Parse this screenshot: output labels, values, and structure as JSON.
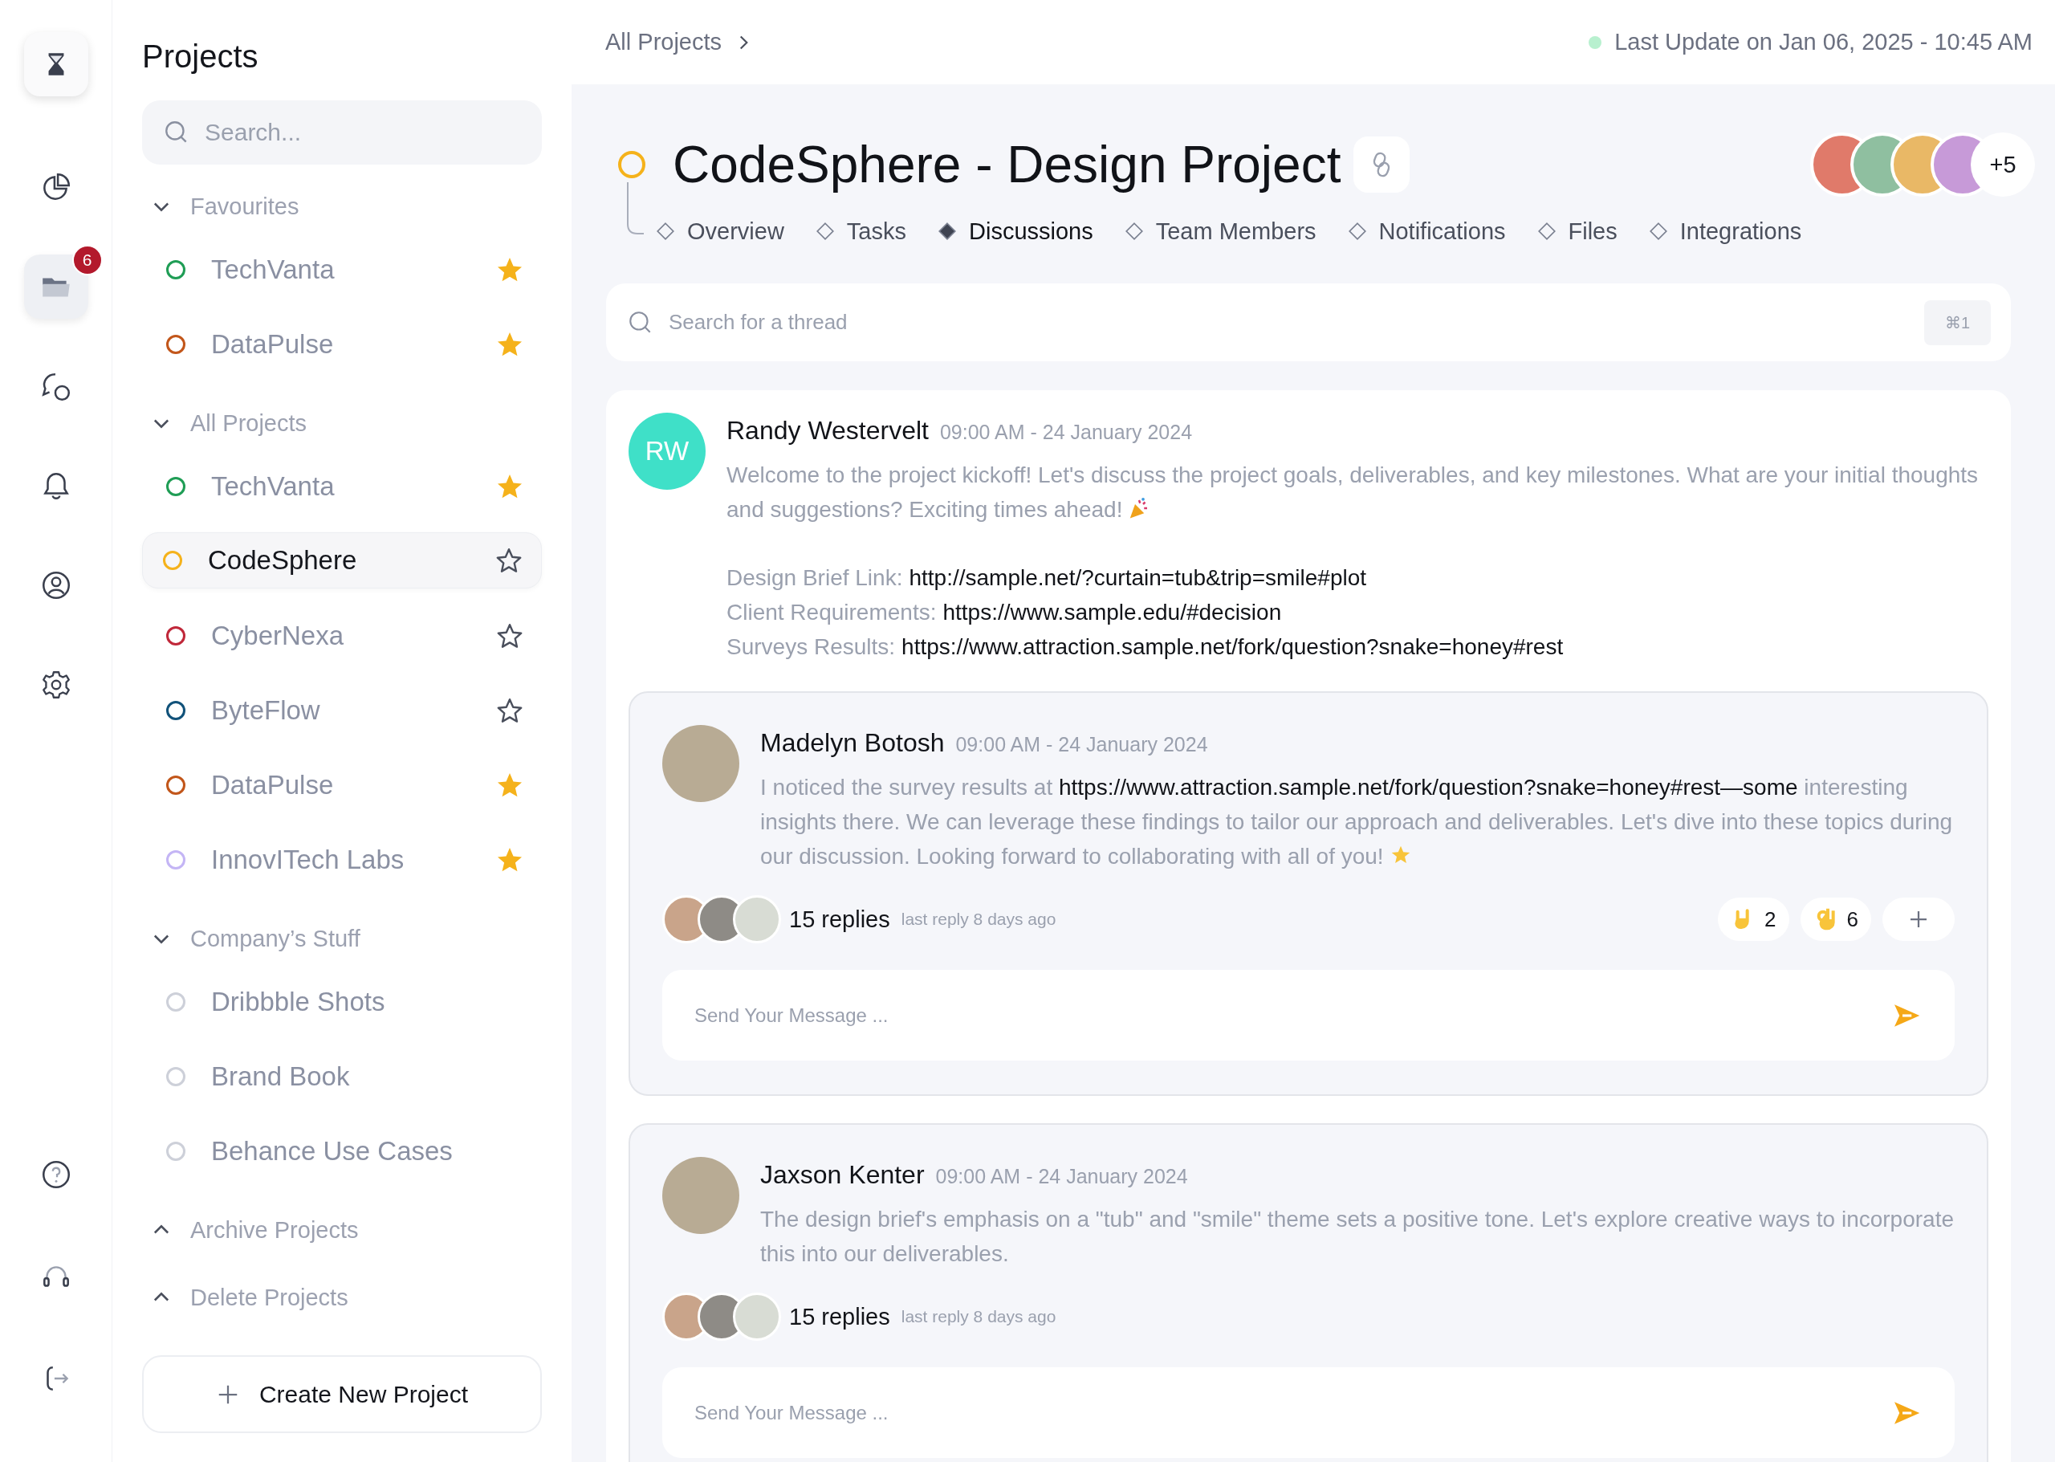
{
  "rail": {
    "top": [
      {
        "kind": "chart",
        "selected": false
      },
      {
        "kind": "folder",
        "selected": true,
        "badge": "6"
      },
      {
        "kind": "chat",
        "selected": false
      },
      {
        "kind": "bell",
        "selected": false
      },
      {
        "kind": "user",
        "selected": false
      },
      {
        "kind": "gear",
        "selected": false
      }
    ],
    "bottom": [
      {
        "kind": "help",
        "selected": false
      },
      {
        "kind": "headset",
        "selected": false
      },
      {
        "kind": "logout",
        "selected": false
      }
    ]
  },
  "sidebar": {
    "title": "Projects",
    "search": {
      "placeholder": "Search..."
    },
    "sections": [
      {
        "label": "Favourites",
        "expanded": true,
        "items": [
          {
            "name": "TechVanta",
            "color": "#1f9d55",
            "starred": true,
            "selected": false
          },
          {
            "name": "DataPulse",
            "color": "#c2561a",
            "starred": true,
            "selected": false
          }
        ]
      },
      {
        "label": "All Projects",
        "expanded": true,
        "items": [
          {
            "name": "TechVanta",
            "color": "#1f9d55",
            "starred": true,
            "selected": false
          },
          {
            "name": "CodeSphere",
            "color": "#f5b21b",
            "starred": false,
            "selected": true
          },
          {
            "name": "CyberNexa",
            "color": "#c0283a",
            "starred": false,
            "selected": false
          },
          {
            "name": "ByteFlow",
            "color": "#11527a",
            "starred": false,
            "selected": false
          },
          {
            "name": "DataPulse",
            "color": "#c2561a",
            "starred": true,
            "selected": false
          },
          {
            "name": "InnovITech Labs",
            "color": "#c4b5f5",
            "starred": true,
            "selected": false
          }
        ]
      },
      {
        "label": "Company’s Stuff",
        "expanded": true,
        "items": [
          {
            "name": "Dribbble Shots",
            "color": "#cdd0d9",
            "selected": false
          },
          {
            "name": "Brand Book",
            "color": "#cdd0d9",
            "selected": false
          },
          {
            "name": "Behance Use Cases",
            "color": "#cdd0d9",
            "selected": false
          }
        ]
      },
      {
        "label": "Archive Projects",
        "expanded": false
      },
      {
        "label": "Delete Projects",
        "expanded": false
      }
    ],
    "create_button": "Create New Project"
  },
  "header": {
    "breadcrumb": "All Projects",
    "last_update": "Last Update on Jan 06, 2025 - 10:45 AM"
  },
  "project": {
    "title": "CodeSphere - Design Project",
    "more_members": "+5",
    "tabs": [
      {
        "label": "Overview",
        "selected": false
      },
      {
        "label": "Tasks",
        "selected": false
      },
      {
        "label": "Discussions",
        "selected": true
      },
      {
        "label": "Team Members",
        "selected": false
      },
      {
        "label": "Notifications",
        "selected": false
      },
      {
        "label": "Files",
        "selected": false
      },
      {
        "label": "Integrations",
        "selected": false
      }
    ]
  },
  "thread_search": {
    "placeholder": "Search for a thread",
    "shortcut": "⌘1"
  },
  "post": {
    "initials": "RW",
    "author": "Randy Westervelt",
    "time": "09:00 AM - 24 January 2024",
    "body": "Welcome to the project kickoff! Let's discuss the project goals, deliverables, and key milestones. What are your initial thoughts and suggestions? Exciting times ahead!",
    "links": [
      {
        "label": "Design Brief Link:",
        "url": "http://sample.net/?curtain=tub&trip=smile#plot"
      },
      {
        "label": "Client Requirements:",
        "url": "https://www.sample.edu/#decision"
      },
      {
        "label": "Surveys Results:",
        "url": "https://www.attraction.sample.net/fork/question?snake=honey#rest"
      }
    ],
    "threads": [
      {
        "author": "Madelyn Botosh",
        "time": "09:00 AM - 24 January 2024",
        "body": [
          {
            "kind": "text",
            "text": "I noticed the survey results at "
          },
          {
            "kind": "link",
            "text": "https://www.attraction.sample.net/fork/question?snake=honey#rest—some"
          },
          {
            "kind": "text",
            "text": " interesting insights there. We can leverage these findings to tailor our approach and deliverables. Let's dive into these topics during our discussion. Looking forward to collaborating with all of you!"
          }
        ],
        "replies": "15 replies",
        "last_reply": "last reply 8 days ago",
        "reactions": [
          {
            "kind": "rock",
            "count": "2"
          },
          {
            "kind": "ok",
            "count": "6"
          }
        ],
        "composer": {
          "placeholder": "Send Your Message ..."
        }
      },
      {
        "author": "Jaxson Kenter",
        "time": "09:00 AM - 24 January 2024",
        "body": [
          {
            "kind": "text",
            "text": "The design brief's emphasis on a \"tub\" and \"smile\" theme sets a positive tone. Let's explore creative ways to incorporate this into our deliverables."
          }
        ],
        "replies": "15 replies",
        "last_reply": "last reply 8 days ago",
        "composer": {
          "placeholder": "Send Your Message ..."
        }
      }
    ]
  }
}
